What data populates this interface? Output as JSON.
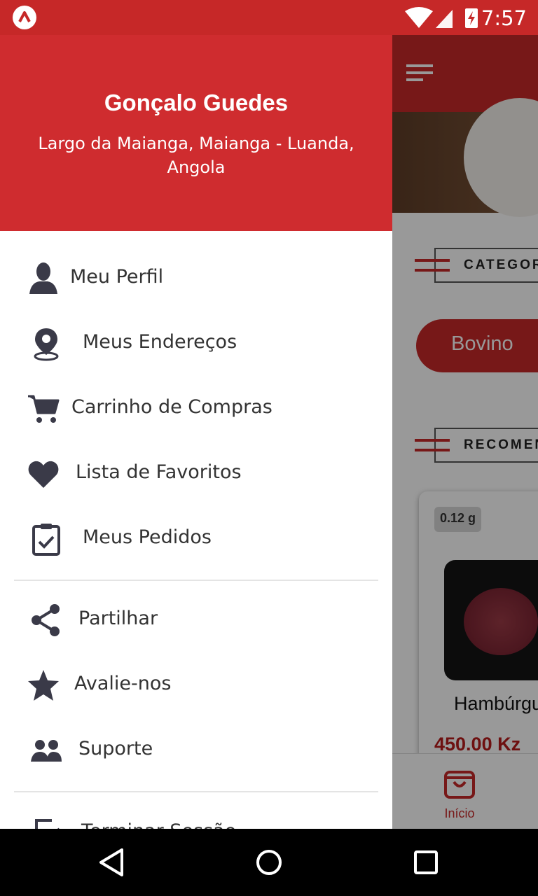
{
  "status_bar": {
    "time": "7:57",
    "app_icon": "app-logo-icon",
    "icons": [
      "wifi-icon",
      "signal-icon",
      "battery-charging-icon"
    ]
  },
  "drawer": {
    "user_name": "Gonçalo Guedes",
    "user_address": "Largo da Maianga, Maianga - Luanda, Angola",
    "menu_primary": [
      {
        "label": "Meu Perfil",
        "icon": "person-icon"
      },
      {
        "label": "Meus Endereços",
        "icon": "location-pin-icon"
      },
      {
        "label": "Carrinho de Compras",
        "icon": "shopping-cart-icon"
      },
      {
        "label": "Lista de Favoritos",
        "icon": "heart-icon"
      },
      {
        "label": "Meus Pedidos",
        "icon": "clipboard-check-icon"
      }
    ],
    "menu_secondary": [
      {
        "label": "Partilhar",
        "icon": "share-icon"
      },
      {
        "label": "Avalie-nos",
        "icon": "star-icon"
      },
      {
        "label": "Suporte",
        "icon": "people-icon"
      }
    ],
    "menu_tertiary": [
      {
        "label": "Terminar Sessão",
        "icon": "logout-icon"
      }
    ]
  },
  "background_app": {
    "menu_icon": "hamburger-menu-icon",
    "section_categories": "CATEGORIAS",
    "category_chip": "Bovino",
    "section_recommended": "RECOMENDADOS",
    "product": {
      "weight": "0.12 g",
      "name": "Hambúrguer",
      "price": "450.00 Kz"
    },
    "bottom_nav": {
      "label": "Início",
      "icon": "shopping-bag-icon"
    }
  },
  "system_nav": {
    "icons": [
      "back-icon",
      "home-icon",
      "recents-icon"
    ]
  },
  "colors": {
    "primary": "#cf2c2f",
    "dark_red": "#b71c1c",
    "icon_gray": "#3a3a48"
  }
}
